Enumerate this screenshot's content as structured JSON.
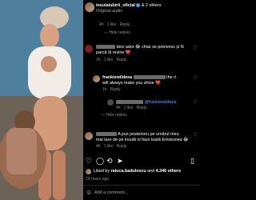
{
  "header": {
    "username": "insulaiubirii_oficial",
    "verified_mark": "✓",
    "others_text": "& 2 others",
    "subtitle": "Original audio"
  },
  "comments": [
    {
      "meta_time": "4h",
      "meta_likes": "1 like",
      "meta_reply": "Reply",
      "hide_replies": "Hide replies"
    },
    {
      "text_line1": "deci ador 😂 chiar se potrivesc și N",
      "text_line2": "parcă îți revine ❤️",
      "meta_time": "1h",
      "meta_likes": "1 like",
      "meta_reply": "Reply"
    },
    {
      "author": "frankiewildeea",
      "text_line1": "the ri",
      "text_line2": "will always make you shine ❤️",
      "meta_time": "1h",
      "meta_reply": "Reply"
    },
    {
      "mention": "@frankiewildeea",
      "meta_time": "4h",
      "meta_likes": "1 like",
      "meta_reply": "Reply",
      "hide_replies": "Hide replies"
    },
    {
      "text_line1": "A pus posterioru pe umărul meu",
      "text_line2": "mai tare de pe insulă ni face toată Emisiunea 😂",
      "meta_time": "4h",
      "meta_likes": "1 like",
      "meta_reply": "Reply"
    }
  ],
  "footer": {
    "likes_prefix": "Liked by",
    "liked_by_user": "raluca.badulescu",
    "likes_and": "and",
    "likes_count": "4,346 others",
    "posted_time": "19 hours ago",
    "add_comment_placeholder": "Add a comment..."
  },
  "colors": {
    "accent_blue": "#3897f0",
    "muted_text": "#a8a8a8",
    "background": "#000000"
  }
}
